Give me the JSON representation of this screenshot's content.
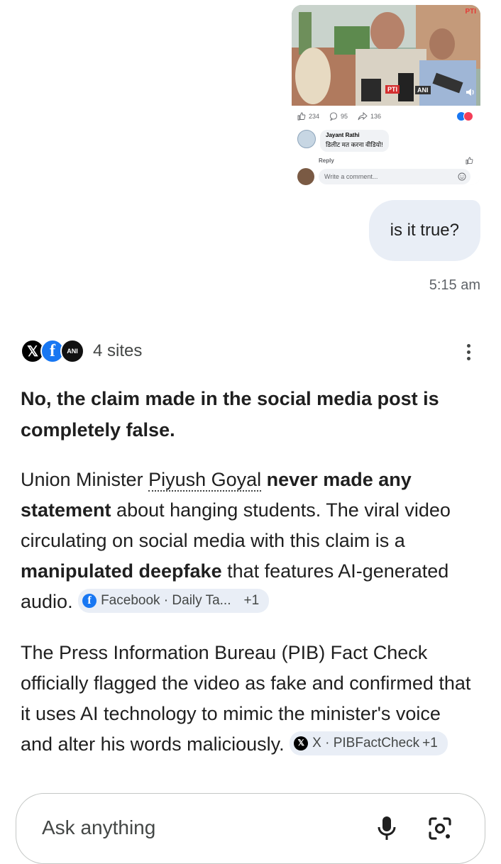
{
  "shared_post": {
    "watermark": "PTI",
    "mic_tags": [
      "PTI",
      "ANI"
    ],
    "likes": "234",
    "comments": "95",
    "shares": "136",
    "commenter_name": "Jayant Rathi",
    "comment_text": "डिलीट मत करना वीडियो!",
    "reply_label": "Reply",
    "write_placeholder": "Write a comment..."
  },
  "user_message": {
    "text": "is it true?",
    "time": "5:15 am"
  },
  "sources": {
    "label": "4 sites",
    "icons": [
      "x-icon",
      "facebook-icon",
      "ani-icon"
    ]
  },
  "answer": {
    "headline": "No, the claim made in the social media post is completely false.",
    "p1": {
      "t1": "Union Minister ",
      "entity": "Piyush Goyal",
      "t2": " ",
      "b1": "never made any statement",
      "t3": " about hanging students. The viral video circulating on social media with this claim is a ",
      "b2": "manipulated deepfake",
      "t4": " that features AI-generated audio. ",
      "chip_label": "Facebook · Daily Ta...",
      "chip_more": "+1"
    },
    "p2": {
      "text": "The Press Information Bureau (PIB) Fact Check officially flagged the video as fake and confirmed that it uses AI technology to mimic the minister's voice and alter his words maliciously. ",
      "chip_label": "X · PIBFactCheck",
      "chip_more": "+1"
    }
  },
  "input": {
    "placeholder": "Ask anything"
  },
  "colors": {
    "user_bubble": "#e9eef6",
    "facebook": "#1877f2",
    "text": "#1f1f1f",
    "muted": "#444746"
  }
}
